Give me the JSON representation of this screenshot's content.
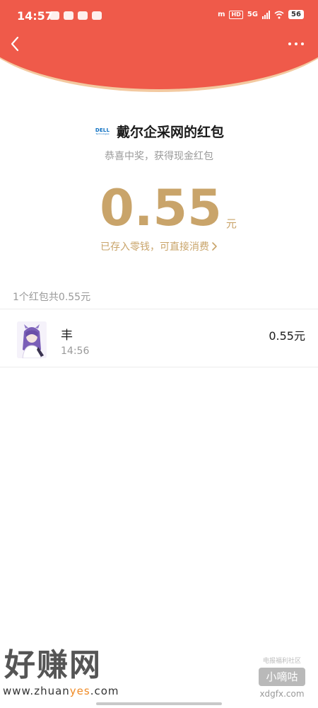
{
  "status_bar": {
    "time": "14:57",
    "carrier_badge": "m",
    "hd": "HD",
    "network": "5G",
    "battery": "56"
  },
  "sender": {
    "logo_text": "DELL",
    "logo_subtext": "Technologies",
    "title": "戴尔企采网的红包",
    "subtitle": "恭喜中奖，获得现金红包"
  },
  "amount": {
    "value": "0.55",
    "unit": "元",
    "wallet_link": "已存入零钱，可直接消费"
  },
  "list": {
    "summary": "1个红包共0.55元",
    "records": [
      {
        "name": "丰",
        "time": "14:56",
        "amount": "0.55元"
      }
    ]
  },
  "watermarks": {
    "left_title": "好赚网",
    "left_url_prefix": "www.zhuan",
    "left_url_accent": "yes",
    "left_url_suffix": ".com",
    "right_small": "电报福利社区",
    "right_box": "小嘀咕",
    "right_url": "xdgfx.com"
  },
  "colors": {
    "header_red": "#ef5a4a",
    "gold": "#c9a46a",
    "header_rim": "#f3c9a0"
  },
  "icons": {
    "back": "chevron-left-icon",
    "more": "more-dots-icon",
    "link": "chevron-right-icon"
  }
}
